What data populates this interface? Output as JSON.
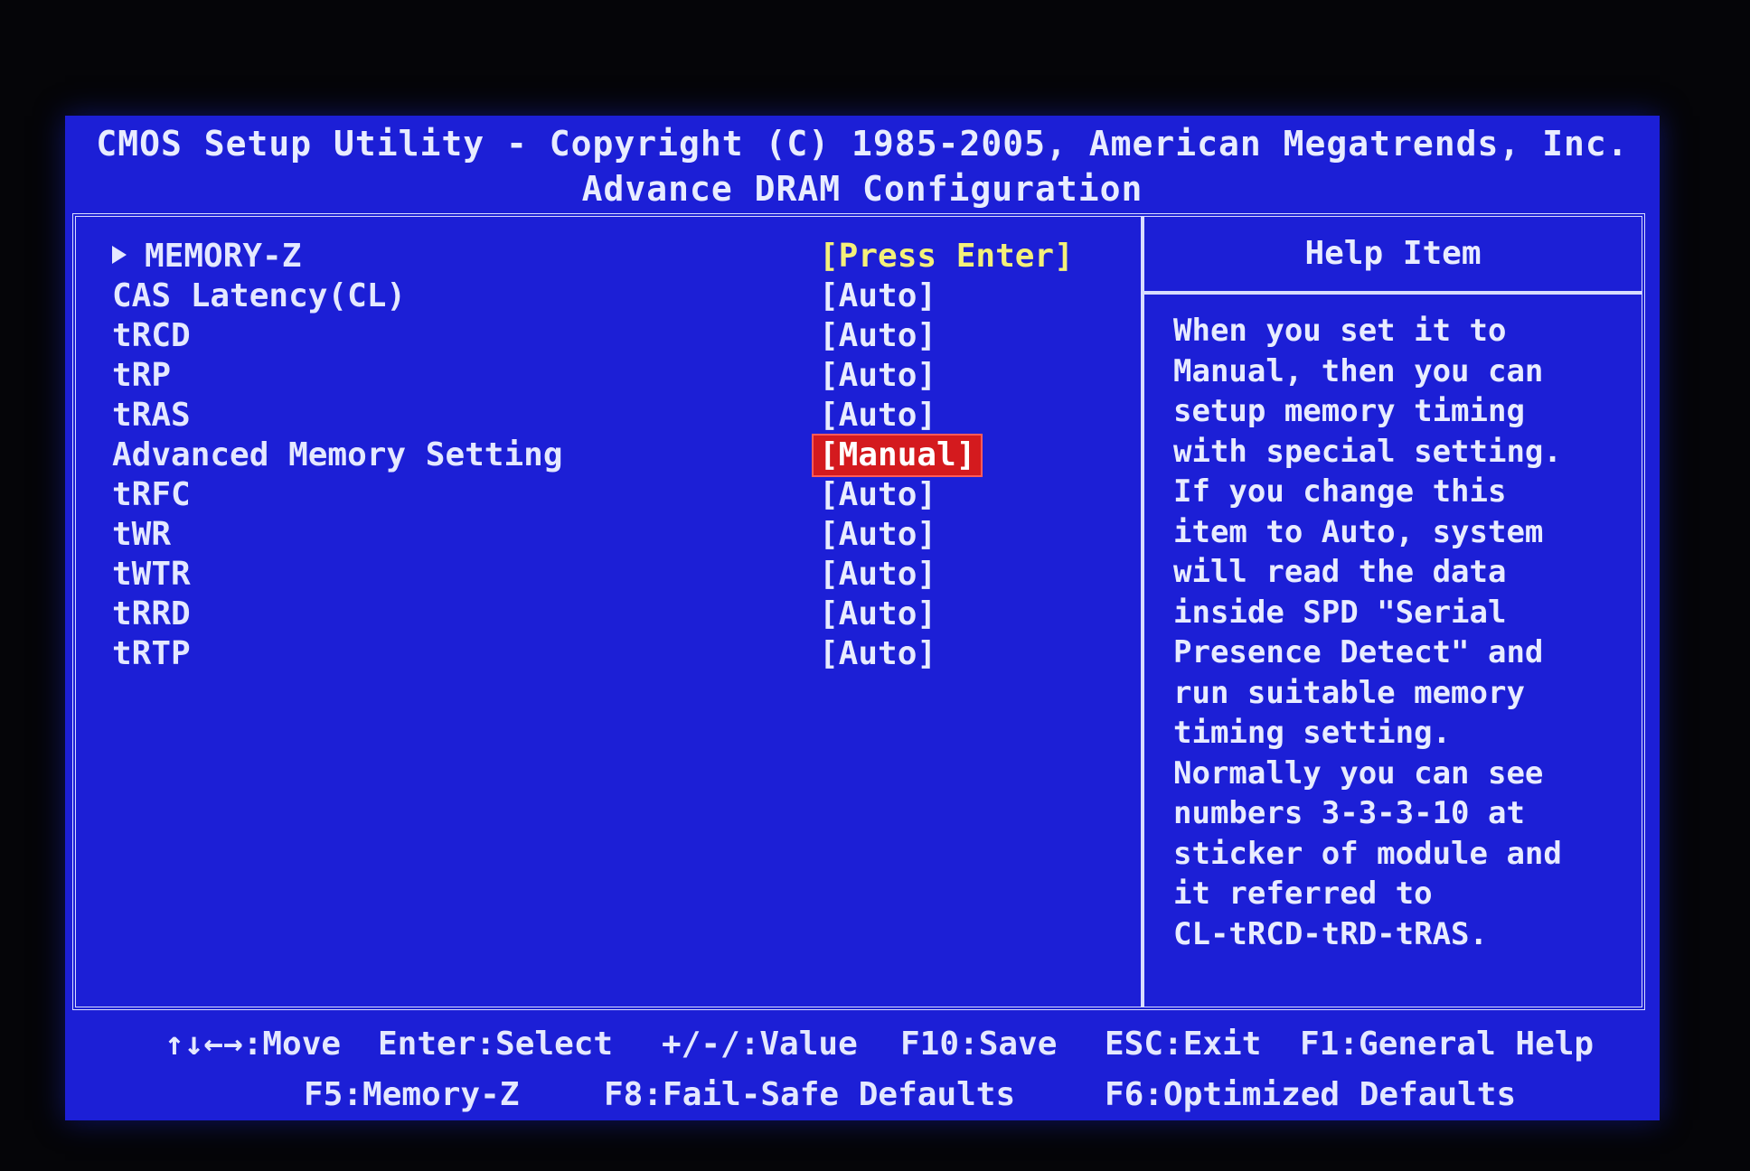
{
  "header": {
    "title": "CMOS Setup Utility - Copyright (C) 1985-2005, American Megatrends, Inc.",
    "subtitle": "Advance DRAM Configuration"
  },
  "settings": [
    {
      "label": "MEMORY-Z",
      "value": "[Press Enter]",
      "submenu": true
    },
    {
      "label": "CAS Latency(CL)",
      "value": "[Auto]"
    },
    {
      "label": "tRCD",
      "value": "[Auto]"
    },
    {
      "label": "tRP",
      "value": "[Auto]"
    },
    {
      "label": "tRAS",
      "value": "[Auto]"
    },
    {
      "label": "Advanced Memory Setting",
      "value": "[Manual]",
      "selected": true
    },
    {
      "label": "tRFC",
      "value": "[Auto]"
    },
    {
      "label": "tWR",
      "value": "[Auto]"
    },
    {
      "label": "tWTR",
      "value": "[Auto]"
    },
    {
      "label": "tRRD",
      "value": "[Auto]"
    },
    {
      "label": "tRTP",
      "value": "[Auto]"
    }
  ],
  "help": {
    "title": "Help Item",
    "lines": [
      "When you set it to",
      "Manual, then you can",
      "setup memory timing",
      "with special setting.",
      "If you change this",
      "item to Auto, system",
      "will read the data",
      "inside SPD \"Serial",
      "Presence Detect\" and",
      "run suitable memory",
      "timing setting.",
      "Normally you can see",
      "numbers 3-3-3-10 at",
      "sticker of module and",
      "it referred to",
      "CL-tRCD-tRD-tRAS."
    ]
  },
  "footer": {
    "move": "↑↓←→:Move",
    "select": "Enter:Select",
    "value": "+/-/:Value",
    "save": "F10:Save",
    "exit": "ESC:Exit",
    "general_help": "F1:General Help",
    "memory_z": "F5:Memory-Z",
    "failsafe": "F8:Fail-Safe Defaults",
    "optimized": "F6:Optimized Defaults"
  },
  "colors": {
    "background": "#1c1fd6",
    "text": "#e4e8ff",
    "highlight": "#d41a1e",
    "submenu_value": "#f4f07a"
  }
}
